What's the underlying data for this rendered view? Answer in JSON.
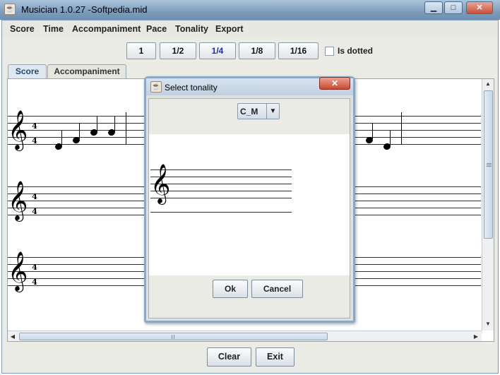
{
  "window": {
    "title": "Musician 1.0.27 -Softpedia.mid"
  },
  "titlebar_buttons": {
    "minimize": "▁",
    "maximize": "□",
    "close": "✕"
  },
  "menu": [
    "Score",
    "Time",
    "Accompaniment",
    "Pace",
    "Tonality",
    "Export"
  ],
  "durations": [
    {
      "label": "1",
      "selected": false
    },
    {
      "label": "1/2",
      "selected": false
    },
    {
      "label": "1/4",
      "selected": true
    },
    {
      "label": "1/8",
      "selected": false
    },
    {
      "label": "1/16",
      "selected": false
    }
  ],
  "dotted": {
    "label": "Is dotted",
    "checked": false
  },
  "tabs": [
    {
      "label": "Score",
      "active": true
    },
    {
      "label": "Accompaniment",
      "active": false
    }
  ],
  "score": {
    "time_signature": {
      "top": "4",
      "bottom": "4"
    },
    "clef_glyph": "𝄞"
  },
  "bottom_buttons": {
    "clear": "Clear",
    "exit": "Exit"
  },
  "dialog": {
    "title": "Select tonality",
    "close_glyph": "✕",
    "tonality_value": "C_M",
    "dropdown_glyph": "▼",
    "ok": "Ok",
    "cancel": "Cancel"
  },
  "icons": {
    "app": "java-cup-icon"
  },
  "colors": {
    "selected_duration": "#1a2bbd",
    "active_tab_text": "#264a76"
  }
}
